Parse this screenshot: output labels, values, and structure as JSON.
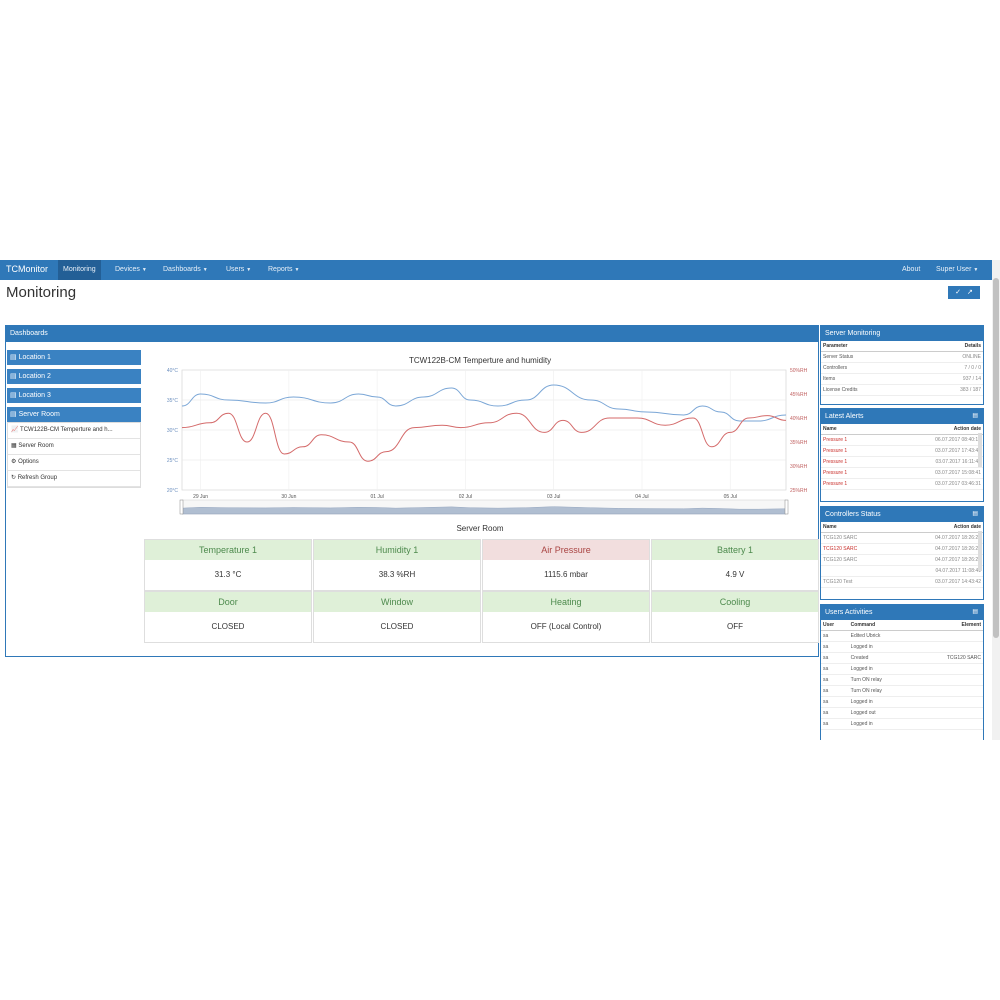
{
  "navbar": {
    "brand": "TCMonitor",
    "items": [
      {
        "label": "Monitoring"
      },
      {
        "label": "Devices"
      },
      {
        "label": "Dashboards"
      },
      {
        "label": "Users"
      },
      {
        "label": "Reports"
      }
    ],
    "about": "About",
    "user": "Super User"
  },
  "page": {
    "title": "Monitoring"
  },
  "dashboards": {
    "title": "Dashboards",
    "locations": [
      "Location 1",
      "Location 2",
      "Location 3",
      "Server Room"
    ],
    "sub_items": [
      "TCW122B-CM Temperture and h...",
      "Server Room",
      "Options",
      "Refresh Group"
    ]
  },
  "chart": {
    "title": "TCW122B-CM Temperture and humidity",
    "left_ticks": [
      "40°C",
      "35°C",
      "30°C",
      "25°C",
      "20°C"
    ],
    "right_ticks": [
      "50%RH",
      "45%RH",
      "40%RH",
      "35%RH",
      "30%RH",
      "25%RH"
    ],
    "x_ticks": [
      "29 Jun",
      "30 Jun",
      "01 Jul",
      "02 Jul",
      "03 Jul",
      "04 Jul",
      "05 Jul"
    ]
  },
  "chart_data": {
    "type": "line",
    "title": "TCW122B-CM Temperture and humidity",
    "x": [
      "29 Jun",
      "30 Jun",
      "01 Jul",
      "02 Jul",
      "03 Jul",
      "04 Jul",
      "05 Jul"
    ],
    "ylim_left": [
      20,
      40
    ],
    "ylim_right": [
      25,
      50
    ],
    "grid": true,
    "series": [
      {
        "color": "#7aa6d6",
        "axis": "left",
        "x": [
          0,
          0.2,
          0.5,
          0.9,
          1.2,
          1.6,
          1.9,
          2.1,
          2.3,
          2.6,
          2.9,
          3.1,
          3.4,
          3.7,
          4.0,
          4.4,
          4.7,
          5.0,
          5.4,
          5.6,
          5.8,
          6.0,
          6.2,
          6.5
        ],
        "y": [
          34,
          36,
          35,
          34.5,
          35.5,
          34.5,
          36,
          35.5,
          34,
          35.5,
          37,
          35,
          34,
          35,
          37.5,
          35,
          33.5,
          33,
          32.5,
          34,
          33,
          31.5,
          31.5,
          32.5
        ]
      },
      {
        "color": "#d46a6a",
        "axis": "right",
        "x": [
          0,
          0.3,
          0.5,
          0.7,
          0.9,
          1.1,
          1.3,
          1.5,
          1.8,
          2.0,
          2.2,
          2.5,
          2.8,
          3.0,
          3.3,
          3.6,
          3.9,
          4.1,
          4.3,
          4.6,
          4.9,
          5.2,
          5.5,
          5.7,
          5.9,
          6.1,
          6.3,
          6.5
        ],
        "y": [
          38,
          39,
          41,
          35,
          41,
          32.5,
          34,
          36.5,
          35,
          31,
          33,
          38,
          38.5,
          38,
          39,
          41,
          37,
          39.5,
          37,
          40,
          40,
          38.5,
          40,
          34,
          37,
          40,
          40.5,
          39.5
        ]
      }
    ]
  },
  "server_room": {
    "title": "Server Room",
    "tiles": [
      {
        "label": "Temperature 1",
        "value": "31.3 °C",
        "alert": false
      },
      {
        "label": "Humidity 1",
        "value": "38.3 %RH",
        "alert": false
      },
      {
        "label": "Air Pressure",
        "value": "1115.6 mbar",
        "alert": true
      },
      {
        "label": "Battery 1",
        "value": "4.9 V",
        "alert": false
      },
      {
        "label": "Door",
        "value": "CLOSED",
        "alert": false
      },
      {
        "label": "Window",
        "value": "CLOSED",
        "alert": false
      },
      {
        "label": "Heating",
        "value": "OFF (Local Control)",
        "alert": false
      },
      {
        "label": "Cooling",
        "value": "OFF",
        "alert": false
      }
    ]
  },
  "server_monitoring": {
    "title": "Server Monitoring",
    "headers": [
      "Parameter",
      "Details"
    ],
    "rows": [
      [
        "Server Status",
        "ONLINE"
      ],
      [
        "Controllers",
        "7 / 0 / 0"
      ],
      [
        "Items",
        "937 / 14"
      ],
      [
        "License Credits",
        "383 / 187"
      ]
    ]
  },
  "latest_alerts": {
    "title": "Latest Alerts",
    "headers": [
      "Name",
      "Action date"
    ],
    "rows": [
      [
        "Pressure 1",
        "06.07.2017 08:40:14"
      ],
      [
        "Pressure 1",
        "03.07.2017 17:43:41"
      ],
      [
        "Pressure 1",
        "03.07.2017 16:11:42"
      ],
      [
        "Pressure 1",
        "03.07.2017 15:08:41"
      ],
      [
        "Pressure 1",
        "03.07.2017 03:46:31"
      ]
    ]
  },
  "controllers_status": {
    "title": "Controllers Status",
    "headers": [
      "Name",
      "Action date"
    ],
    "rows": [
      [
        "TCG120 SARC",
        "04.07.2017 18:26:26"
      ],
      [
        "TCG120 SARC",
        "04.07.2017 18:26:26"
      ],
      [
        "TCG120 SARC",
        "04.07.2017 18:26:26"
      ],
      [
        "",
        "04.07.2017 11:08:41"
      ],
      [
        "TCG120 Test",
        "03.07.2017 14:43:42"
      ]
    ]
  },
  "users_activities": {
    "title": "Users Activities",
    "headers": [
      "User",
      "Command",
      "Element"
    ],
    "rows": [
      [
        "sa",
        "Edited Ubrick",
        ""
      ],
      [
        "sa",
        "Logged in",
        ""
      ],
      [
        "sa",
        "Created",
        "TCG120 SARC"
      ],
      [
        "sa",
        "Logged in",
        ""
      ],
      [
        "sa",
        "Turn ON relay",
        ""
      ],
      [
        "sa",
        "Turn ON relay",
        ""
      ],
      [
        "sa",
        "Logged in",
        ""
      ],
      [
        "sa",
        "Logged out",
        ""
      ],
      [
        "sa",
        "Logged in",
        ""
      ]
    ]
  }
}
